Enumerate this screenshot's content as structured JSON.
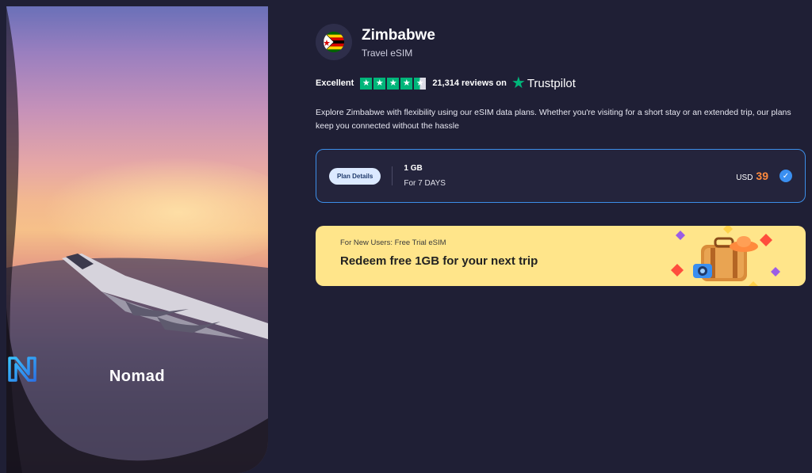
{
  "brand": {
    "name": "Nomad",
    "logo_icon": "nomad-logo-icon"
  },
  "country": {
    "name": "Zimbabwe",
    "subtitle": "Travel eSIM",
    "flag_icon": "zimbabwe-flag-icon"
  },
  "rating": {
    "label": "Excellent",
    "stars": 4.5,
    "reviews_text": "21,314 reviews on",
    "provider": "Trustpilot",
    "star_color": "#00b67a"
  },
  "description": "Explore Zimbabwe with flexibility using our eSIM data plans. Whether you're visiting for a short stay or an extended trip, our plans keep you connected without the hassle",
  "plan": {
    "details_label": "Plan Details",
    "data": "1 GB",
    "duration": "For 7 DAYS",
    "currency": "USD",
    "price": "39",
    "selected": true,
    "accent_color": "#3c8ee8",
    "price_color": "#ff8a3d"
  },
  "promo": {
    "small": "For New Users: Free Trial eSIM",
    "headline": "Redeem free 1GB for your next trip",
    "background": "#ffe58a",
    "art_icon": "suitcase-camera-illustration"
  }
}
